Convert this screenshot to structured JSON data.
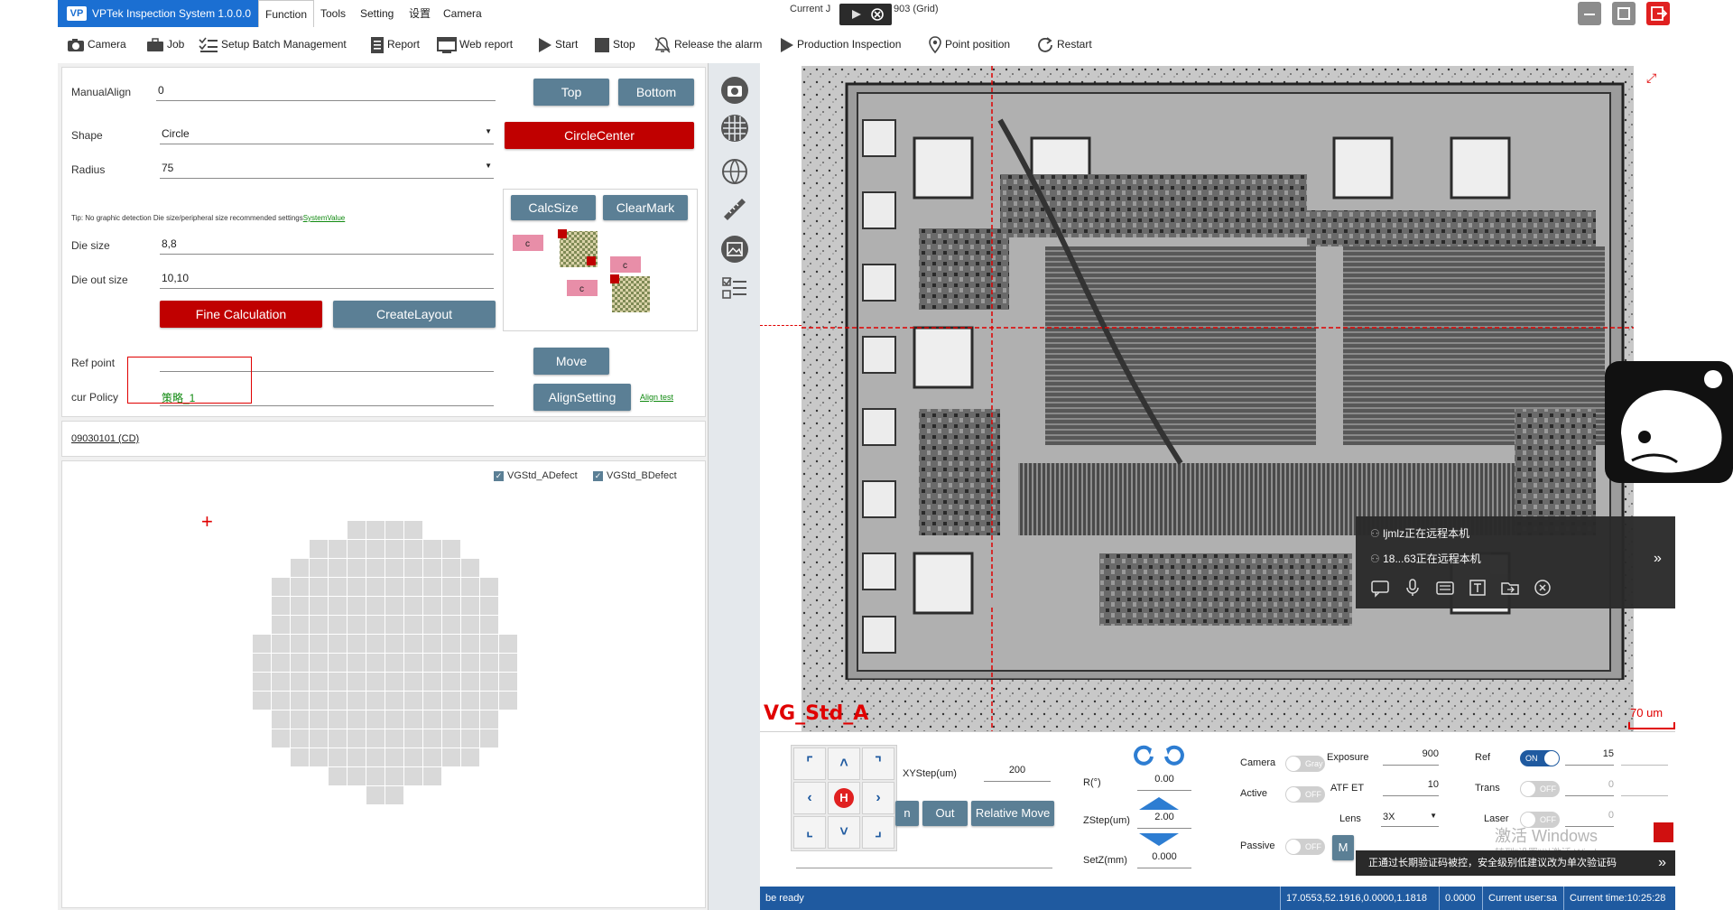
{
  "titlebar": {
    "app_title": "VPTek Inspection System 1.0.0.0",
    "menus": [
      "Function",
      "Tools",
      "Setting",
      "设置",
      "Camera"
    ],
    "current_job_prefix": "Current J",
    "current_job_suffix": "903 (Grid)"
  },
  "toolbar": {
    "items": [
      "Camera",
      "Job",
      "Setup Batch Management",
      "Report",
      "Web report",
      "Start",
      "Stop",
      "Release the alarm",
      "Production Inspection",
      "Point position",
      "Restart"
    ]
  },
  "align": {
    "manual_align_label": "ManualAlign",
    "manual_align_value": "0",
    "top_button": "Top",
    "bottom_button": "Bottom",
    "shape_label": "Shape",
    "shape_value": "Circle",
    "circle_center_button": "CircleCenter",
    "radius_label": "Radius",
    "radius_value": "75",
    "tip_text": "Tip: No graphic detection Die size/peripheral size recommended settings",
    "tip_link": "SystemValue",
    "die_size_label": "Die size",
    "die_size_value": "8,8",
    "die_out_size_label": "Die out size",
    "die_out_size_value": "10,10",
    "fine_calc_button": "Fine Calculation",
    "create_layout_button": "CreateLayout",
    "calc_size_button": "CalcSize",
    "clear_mark_button": "ClearMark",
    "mark_label": "c",
    "ref_point_label": "Ref point",
    "ref_point_value": "",
    "move_button": "Move",
    "cur_policy_label": "cur Policy",
    "cur_policy_value": "策略_1",
    "align_setting_button": "AlignSetting",
    "align_test_link": "Align test"
  },
  "wafer": {
    "job_link": "09030101 (CD)",
    "checkbox_a": "VGStd_ADefect",
    "checkbox_b": "VGStd_BDefect",
    "checkbox_a_checked": true,
    "checkbox_b_checked": true,
    "row_counts": [
      4,
      8,
      10,
      12,
      12,
      12,
      14,
      14,
      14,
      14,
      12,
      12,
      10,
      6,
      2
    ]
  },
  "side_icons": [
    "camera-icon",
    "grid-icon",
    "globe-icon",
    "ruler-icon",
    "image-icon",
    "checklist-icon"
  ],
  "image": {
    "recipe_label": "VG_Std_A",
    "scale_label": "70 um"
  },
  "controls": {
    "xystep_label": "XYStep(um)",
    "xystep_value": "200",
    "r_label": "R(°)",
    "r_value": "0.00",
    "zstep_label": "ZStep(um)",
    "zstep_value": "2.00",
    "setz_label": "SetZ(mm)",
    "setz_value": "0.000",
    "in_button": "n",
    "out_button": "Out",
    "relative_move_button": "Relative Move",
    "home_label": "H",
    "camera_label": "Camera",
    "camera_toggle": "Gray",
    "exposure_label": "Exposure",
    "exposure_value": "900",
    "active_label": "Active",
    "active_toggle": "OFF",
    "atf_et_label": "ATF ET",
    "atf_et_value": "10",
    "lens_label": "Lens",
    "lens_value": "3X",
    "passive_label": "Passive",
    "passive_toggle": "OFF",
    "m_button": "M",
    "ref_label": "Ref",
    "ref_toggle": "ON",
    "ref_value": "15",
    "trans_label": "Trans",
    "trans_toggle": "OFF",
    "trans_value": "0",
    "laser_label": "Laser",
    "laser_toggle": "OFF",
    "laser_value": "0"
  },
  "status": {
    "ready": "be ready",
    "coords": "17.0553,52.1916,0.0000,1.1818",
    "z": "0.0000",
    "user": "Current user:sa",
    "time": "Current time:10:25:28"
  },
  "overlay": {
    "remote_line1": "ljmlz正在远程本机",
    "remote_line2": "18...63正在远程本机",
    "watermark": "激活 Windows",
    "watermark2": "转到\"设置\"以激活 Windows。",
    "notice": "正通过长期验证码被控，安全级别低建议改为单次验证码"
  },
  "colors": {
    "accent_blue": "#1b6fd2",
    "button_slate": "#5b7f95",
    "button_red": "#c00000",
    "status_blue": "#1f5aa0",
    "crosshair_red": "#e00000"
  }
}
